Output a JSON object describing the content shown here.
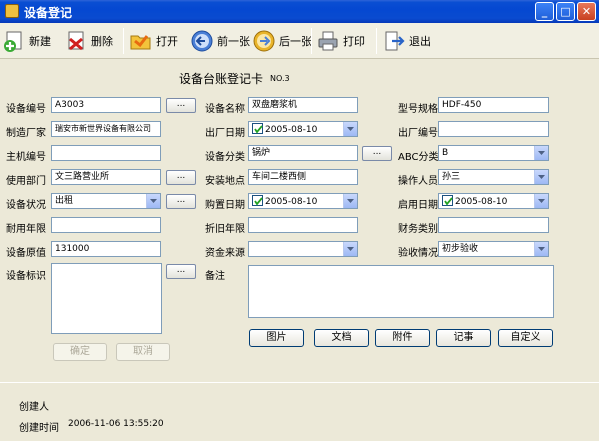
{
  "window": {
    "title": "设备登记"
  },
  "toolbar": {
    "new_label": "新建",
    "delete_label": "删除",
    "open_label": "打开",
    "prev_label": "前一张",
    "next_label": "后一张",
    "print_label": "打印",
    "exit_label": "退出"
  },
  "card": {
    "title": "设备台账登记卡",
    "number": "NO.3"
  },
  "fields": {
    "device_no": {
      "label": "设备编号",
      "value": "A3003"
    },
    "device_name": {
      "label": "设备名称",
      "value": "双盘磨浆机"
    },
    "model": {
      "label": "型号规格",
      "value": "HDF-450"
    },
    "manufacturer": {
      "label": "制造厂家",
      "value": "瑞安市新世界设备有限公司"
    },
    "mfg_date": {
      "label": "出厂日期",
      "value": "2005-08-10"
    },
    "serial_no": {
      "label": "出厂编号",
      "value": ""
    },
    "host_no": {
      "label": "主机编号",
      "value": ""
    },
    "category": {
      "label": "设备分类",
      "value": "锅炉"
    },
    "abc_class": {
      "label": "ABC分类",
      "value": "B"
    },
    "department": {
      "label": "使用部门",
      "value": "文三路营业所"
    },
    "location": {
      "label": "安装地点",
      "value": "车间二楼西侧"
    },
    "operator": {
      "label": "操作人员",
      "value": "孙三"
    },
    "status": {
      "label": "设备状况",
      "value": "出租"
    },
    "purchase_date": {
      "label": "购置日期",
      "value": "2005-08-10"
    },
    "start_date": {
      "label": "启用日期",
      "value": "2005-08-10"
    },
    "life_years": {
      "label": "耐用年限",
      "value": ""
    },
    "depr_years": {
      "label": "折旧年限",
      "value": ""
    },
    "finance_type": {
      "label": "财务类别",
      "value": ""
    },
    "original_value": {
      "label": "设备原值",
      "value": "131000"
    },
    "fund_source": {
      "label": "资金来源",
      "value": ""
    },
    "acceptance": {
      "label": "验收情况",
      "value": "初步验收"
    },
    "identity": {
      "label": "设备标识"
    },
    "remarks": {
      "label": "备注"
    }
  },
  "ellipsis": "...",
  "identity_buttons": {
    "ok": "确定",
    "cancel": "取消"
  },
  "action_buttons": {
    "picture": "图片",
    "document": "文档",
    "attachment": "附件",
    "memo": "记事",
    "custom": "自定义"
  },
  "footer": {
    "creator_label": "创建人",
    "creator_value": "",
    "created_time_label": "创建时间",
    "created_time_value": "2006-11-06 13:55:20"
  }
}
